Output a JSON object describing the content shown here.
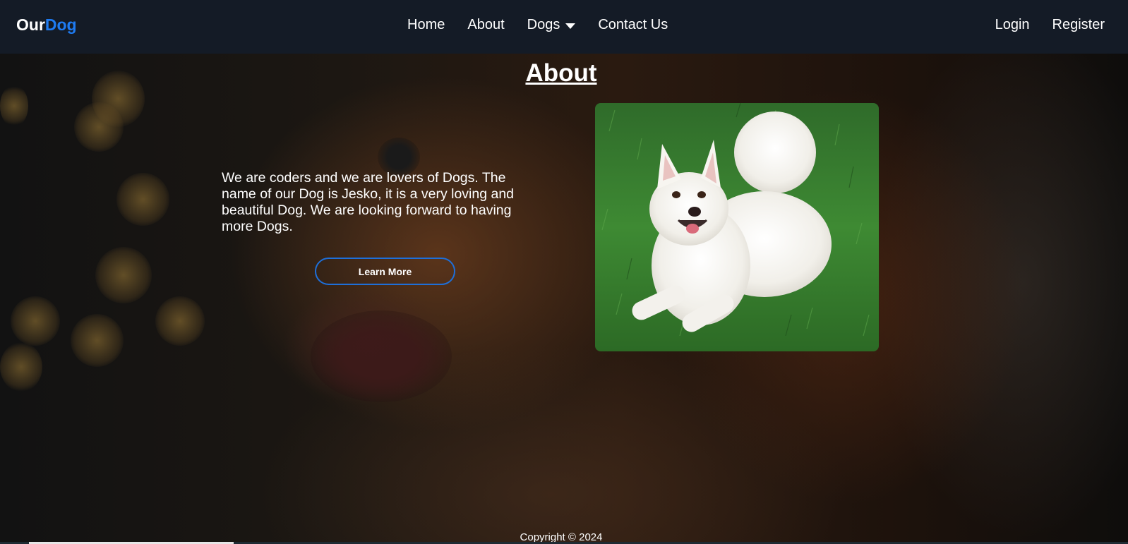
{
  "nav": {
    "brand_part1": "Our",
    "brand_part2": "Dog",
    "links": {
      "home": "Home",
      "about": "About",
      "dogs": "Dogs",
      "contact": "Contact Us"
    },
    "login": "Login",
    "register": "Register"
  },
  "main": {
    "title": "About",
    "description": "We are coders and we are lovers of Dogs. The name of our Dog is Jesko, it is a very loving and beautiful Dog. We are looking forward to having more Dogs.",
    "learn_more": "Learn More"
  },
  "footer": {
    "copyright": "Copyright © 2024"
  },
  "colors": {
    "nav_bg": "#141b26",
    "accent": "#1e7bf2",
    "button_border": "#1e6fd9"
  }
}
